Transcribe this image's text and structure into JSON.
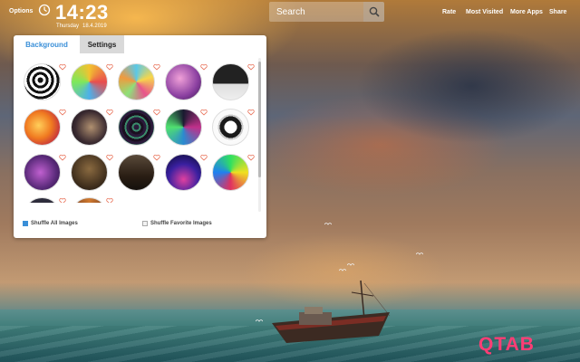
{
  "header": {
    "options_label": "Options",
    "time": "14:23",
    "weekday": "Thursday",
    "date": "18.4.2019",
    "search": {
      "placeholder": "Search"
    },
    "nav": [
      "Rate",
      "Most Visited",
      "More Apps",
      "Share"
    ]
  },
  "panel": {
    "tabs": [
      "Background",
      "Settings"
    ],
    "active_tab": "Background",
    "shuffle_all_label": "Shuffle All Images",
    "shuffle_all_checked": true,
    "shuffle_fav_label": "Shuffle Favorite Images",
    "shuffle_fav_checked": false,
    "thumbnails": [
      "zebra-swirl",
      "psychedelic-pattern",
      "colorful-tiles",
      "pink-galaxy",
      "dark-tree",
      "orange-fractal",
      "dark-canvas",
      "kaleidoscope-tunnel",
      "neon-fractal",
      "black-frame",
      "purple-elephant",
      "dark-orb",
      "vintage-room",
      "neon-trees",
      "neon-leaf",
      "dark-landscape",
      "warm-mandala"
    ]
  },
  "logo": "QTAB",
  "colors": {
    "accent": "#3a8fd8",
    "logo": "#ff3d75",
    "heart": "#e8735a"
  }
}
